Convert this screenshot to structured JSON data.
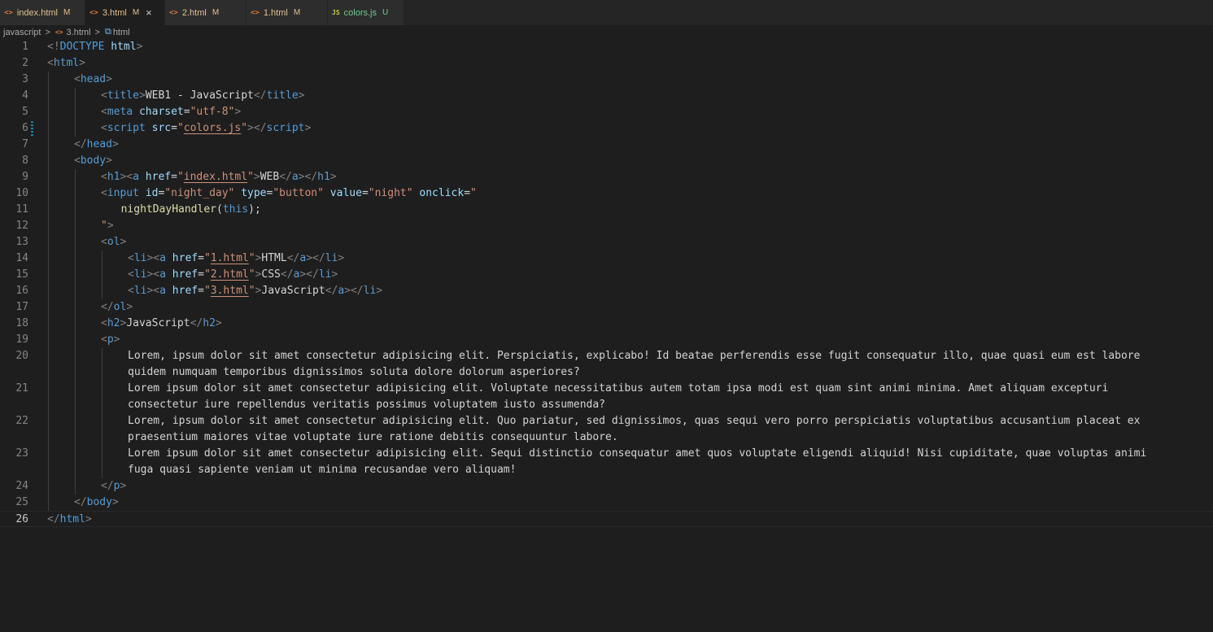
{
  "tabs": [
    {
      "name": "index.html",
      "status": "M",
      "type": "html",
      "active": false,
      "untracked": false,
      "width": 105
    },
    {
      "name": "3.html",
      "status": "M",
      "type": "html",
      "active": true,
      "untracked": false,
      "close": "×",
      "width": 98
    },
    {
      "name": "2.html",
      "status": "M",
      "type": "html",
      "active": false,
      "untracked": false,
      "width": 100
    },
    {
      "name": "1.html",
      "status": "M",
      "type": "html",
      "active": false,
      "untracked": false,
      "width": 100
    },
    {
      "name": "colors.js",
      "status": "U",
      "type": "js",
      "active": false,
      "untracked": true,
      "width": 94
    }
  ],
  "icons": {
    "html": "<>",
    "js": "JS",
    "element": "⧉"
  },
  "breadcrumb": {
    "folder": "javascript",
    "file": "3.html",
    "symbol": "html",
    "separator": ">"
  },
  "editor": {
    "current_line": 26,
    "modified_lines": [
      6
    ],
    "lines": [
      {
        "n": 1,
        "indent": 0,
        "tokens": [
          [
            "p",
            "<!"
          ],
          [
            "t",
            "DOCTYPE"
          ],
          [
            "x",
            " "
          ],
          [
            "a",
            "html"
          ],
          [
            "p",
            ">"
          ]
        ]
      },
      {
        "n": 2,
        "indent": 0,
        "tokens": [
          [
            "p",
            "<"
          ],
          [
            "t",
            "html"
          ],
          [
            "p",
            ">"
          ]
        ]
      },
      {
        "n": 3,
        "indent": 1,
        "tokens": [
          [
            "p",
            "<"
          ],
          [
            "t",
            "head"
          ],
          [
            "p",
            ">"
          ]
        ]
      },
      {
        "n": 4,
        "indent": 2,
        "tokens": [
          [
            "p",
            "<"
          ],
          [
            "t",
            "title"
          ],
          [
            "p",
            ">"
          ],
          [
            "x",
            "WEB1 - JavaScript"
          ],
          [
            "p",
            "</"
          ],
          [
            "t",
            "title"
          ],
          [
            "p",
            ">"
          ]
        ]
      },
      {
        "n": 5,
        "indent": 2,
        "tokens": [
          [
            "p",
            "<"
          ],
          [
            "t",
            "meta"
          ],
          [
            "x",
            " "
          ],
          [
            "a",
            "charset"
          ],
          [
            "x",
            "="
          ],
          [
            "s",
            "\"utf-8\""
          ],
          [
            "p",
            ">"
          ]
        ]
      },
      {
        "n": 6,
        "indent": 2,
        "tokens": [
          [
            "p",
            "<"
          ],
          [
            "t",
            "script"
          ],
          [
            "x",
            " "
          ],
          [
            "a",
            "src"
          ],
          [
            "x",
            "="
          ],
          [
            "s",
            "\""
          ],
          [
            "sl",
            "colors.js"
          ],
          [
            "s",
            "\""
          ],
          [
            "p",
            "></"
          ],
          [
            "t",
            "script"
          ],
          [
            "p",
            ">"
          ]
        ]
      },
      {
        "n": 7,
        "indent": 1,
        "tokens": [
          [
            "p",
            "</"
          ],
          [
            "t",
            "head"
          ],
          [
            "p",
            ">"
          ]
        ]
      },
      {
        "n": 8,
        "indent": 1,
        "tokens": [
          [
            "p",
            "<"
          ],
          [
            "t",
            "body"
          ],
          [
            "p",
            ">"
          ]
        ]
      },
      {
        "n": 9,
        "indent": 2,
        "tokens": [
          [
            "p",
            "<"
          ],
          [
            "t",
            "h1"
          ],
          [
            "p",
            "><"
          ],
          [
            "t",
            "a"
          ],
          [
            "x",
            " "
          ],
          [
            "a",
            "href"
          ],
          [
            "x",
            "="
          ],
          [
            "s",
            "\""
          ],
          [
            "sl",
            "index.html"
          ],
          [
            "s",
            "\""
          ],
          [
            "p",
            ">"
          ],
          [
            "x",
            "WEB"
          ],
          [
            "p",
            "</"
          ],
          [
            "t",
            "a"
          ],
          [
            "p",
            "></"
          ],
          [
            "t",
            "h1"
          ],
          [
            "p",
            ">"
          ]
        ]
      },
      {
        "n": 10,
        "indent": 2,
        "tokens": [
          [
            "p",
            "<"
          ],
          [
            "t",
            "input"
          ],
          [
            "x",
            " "
          ],
          [
            "a",
            "id"
          ],
          [
            "x",
            "="
          ],
          [
            "s",
            "\"night_day\""
          ],
          [
            "x",
            " "
          ],
          [
            "a",
            "type"
          ],
          [
            "x",
            "="
          ],
          [
            "s",
            "\"button\""
          ],
          [
            "x",
            " "
          ],
          [
            "a",
            "value"
          ],
          [
            "x",
            "="
          ],
          [
            "s",
            "\"night\""
          ],
          [
            "x",
            " "
          ],
          [
            "a",
            "onclick"
          ],
          [
            "x",
            "="
          ],
          [
            "s",
            "\""
          ]
        ]
      },
      {
        "n": 11,
        "indent": 2,
        "extra": 3,
        "tokens": [
          [
            "f",
            "nightDayHandler"
          ],
          [
            "x",
            "("
          ],
          [
            "k",
            "this"
          ],
          [
            "x",
            ");"
          ]
        ]
      },
      {
        "n": 12,
        "indent": 2,
        "tokens": [
          [
            "s",
            "\""
          ],
          [
            "p",
            ">"
          ]
        ]
      },
      {
        "n": 13,
        "indent": 2,
        "tokens": [
          [
            "p",
            "<"
          ],
          [
            "t",
            "ol"
          ],
          [
            "p",
            ">"
          ]
        ]
      },
      {
        "n": 14,
        "indent": 3,
        "tokens": [
          [
            "p",
            "<"
          ],
          [
            "t",
            "li"
          ],
          [
            "p",
            "><"
          ],
          [
            "t",
            "a"
          ],
          [
            "x",
            " "
          ],
          [
            "a",
            "href"
          ],
          [
            "x",
            "="
          ],
          [
            "s",
            "\""
          ],
          [
            "sl",
            "1.html"
          ],
          [
            "s",
            "\""
          ],
          [
            "p",
            ">"
          ],
          [
            "x",
            "HTML"
          ],
          [
            "p",
            "</"
          ],
          [
            "t",
            "a"
          ],
          [
            "p",
            "></"
          ],
          [
            "t",
            "li"
          ],
          [
            "p",
            ">"
          ]
        ]
      },
      {
        "n": 15,
        "indent": 3,
        "tokens": [
          [
            "p",
            "<"
          ],
          [
            "t",
            "li"
          ],
          [
            "p",
            "><"
          ],
          [
            "t",
            "a"
          ],
          [
            "x",
            " "
          ],
          [
            "a",
            "href"
          ],
          [
            "x",
            "="
          ],
          [
            "s",
            "\""
          ],
          [
            "sl",
            "2.html"
          ],
          [
            "s",
            "\""
          ],
          [
            "p",
            ">"
          ],
          [
            "x",
            "CSS"
          ],
          [
            "p",
            "</"
          ],
          [
            "t",
            "a"
          ],
          [
            "p",
            "></"
          ],
          [
            "t",
            "li"
          ],
          [
            "p",
            ">"
          ]
        ]
      },
      {
        "n": 16,
        "indent": 3,
        "tokens": [
          [
            "p",
            "<"
          ],
          [
            "t",
            "li"
          ],
          [
            "p",
            "><"
          ],
          [
            "t",
            "a"
          ],
          [
            "x",
            " "
          ],
          [
            "a",
            "href"
          ],
          [
            "x",
            "="
          ],
          [
            "s",
            "\""
          ],
          [
            "sl",
            "3.html"
          ],
          [
            "s",
            "\""
          ],
          [
            "p",
            ">"
          ],
          [
            "x",
            "JavaScript"
          ],
          [
            "p",
            "</"
          ],
          [
            "t",
            "a"
          ],
          [
            "p",
            "></"
          ],
          [
            "t",
            "li"
          ],
          [
            "p",
            ">"
          ]
        ]
      },
      {
        "n": 17,
        "indent": 2,
        "tokens": [
          [
            "p",
            "</"
          ],
          [
            "t",
            "ol"
          ],
          [
            "p",
            ">"
          ]
        ]
      },
      {
        "n": 18,
        "indent": 2,
        "tokens": [
          [
            "p",
            "<"
          ],
          [
            "t",
            "h2"
          ],
          [
            "p",
            ">"
          ],
          [
            "x",
            "JavaScript"
          ],
          [
            "p",
            "</"
          ],
          [
            "t",
            "h2"
          ],
          [
            "p",
            ">"
          ]
        ]
      },
      {
        "n": 19,
        "indent": 2,
        "tokens": [
          [
            "p",
            "<"
          ],
          [
            "t",
            "p"
          ],
          [
            "p",
            ">"
          ]
        ]
      },
      {
        "n": 20,
        "indent": 3,
        "tokens": [
          [
            "x",
            "Lorem, ipsum dolor sit amet consectetur adipisicing elit. Perspiciatis, explicabo! Id beatae perferendis esse fugit consequatur illo, quae quasi eum est labore"
          ]
        ],
        "wrap": "quidem numquam temporibus dignissimos soluta dolore dolorum asperiores?"
      },
      {
        "n": 21,
        "indent": 3,
        "tokens": [
          [
            "x",
            "Lorem ipsum dolor sit amet consectetur adipisicing elit. Voluptate necessitatibus autem totam ipsa modi est quam sint animi minima. Amet aliquam excepturi"
          ]
        ],
        "wrap": "consectetur iure repellendus veritatis possimus voluptatem iusto assumenda?"
      },
      {
        "n": 22,
        "indent": 3,
        "tokens": [
          [
            "x",
            "Lorem, ipsum dolor sit amet consectetur adipisicing elit. Quo pariatur, sed dignissimos, quas sequi vero porro perspiciatis voluptatibus accusantium placeat ex"
          ]
        ],
        "wrap": "praesentium maiores vitae voluptate iure ratione debitis consequuntur labore."
      },
      {
        "n": 23,
        "indent": 3,
        "tokens": [
          [
            "x",
            "Lorem ipsum dolor sit amet consectetur adipisicing elit. Sequi distinctio consequatur amet quos voluptate eligendi aliquid! Nisi cupiditate, quae voluptas animi"
          ]
        ],
        "wrap": "fuga quasi sapiente veniam ut minima recusandae vero aliquam!"
      },
      {
        "n": 24,
        "indent": 2,
        "tokens": [
          [
            "p",
            "</"
          ],
          [
            "t",
            "p"
          ],
          [
            "p",
            ">"
          ]
        ]
      },
      {
        "n": 25,
        "indent": 1,
        "tokens": [
          [
            "p",
            "</"
          ],
          [
            "t",
            "body"
          ],
          [
            "p",
            ">"
          ]
        ]
      },
      {
        "n": 26,
        "indent": 0,
        "tokens": [
          [
            "p",
            "</"
          ],
          [
            "t",
            "html"
          ],
          [
            "p",
            ">"
          ]
        ]
      }
    ]
  }
}
